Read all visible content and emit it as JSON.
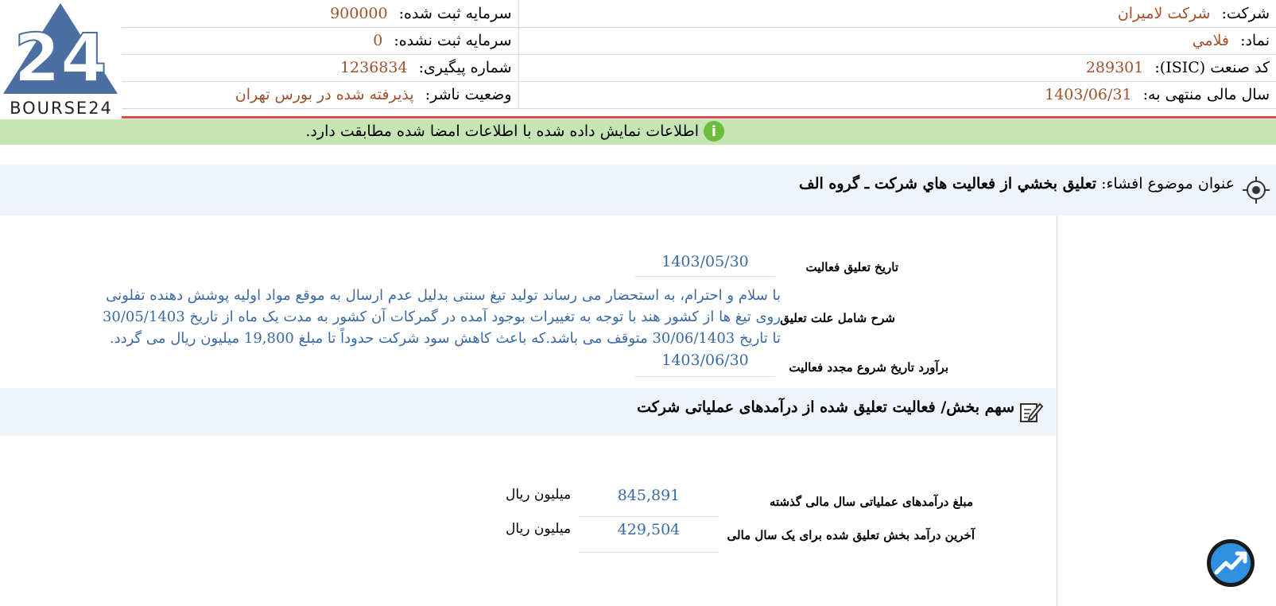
{
  "logo": {
    "text": "BOURSE24"
  },
  "header": {
    "rows": [
      {
        "right_label": "شرکت:",
        "right_value": "شرکت لامیران",
        "left_label": "سرمایه ثبت شده:",
        "left_value": "900000"
      },
      {
        "right_label": "نماد:",
        "right_value": "فلامي",
        "left_label": "سرمایه ثبت نشده:",
        "left_value": "0"
      },
      {
        "right_label": "کد صنعت (ISIC):",
        "right_value": "289301",
        "left_label": "شماره پیگیری:",
        "left_value": "1236834"
      },
      {
        "right_label": "سال مالی منتهی به:",
        "right_value": "1403/06/31",
        "left_label": "وضعیت ناشر:",
        "left_value": "پذیرفته شده در بورس تهران"
      }
    ]
  },
  "notice": {
    "text": "اطلاعات نمایش داده شده با اطلاعات امضا شده مطابقت دارد.",
    "icon": "info-icon"
  },
  "disclosure": {
    "title_label": "عنوان موضوع افشاء:",
    "title_value": "تعليق بخشي از فعاليت هاي شرکت ـ گروه الف",
    "suspension_date_label": "تاریخ تعلیق فعالیت",
    "suspension_date": "1403/05/30",
    "reason_label": "شرح شامل علت تعلیق",
    "reason_text": "با سلام و احترام، به استحضار می رساند تولید تیغ سنتی بدلیل عدم ارسال به موقع مواد اولیه پوشش دهنده تفلونی روی تیغ ها از کشور هند با توجه به تغییرات بوجود آمده در گمرکات آن کشور به مدت یک ماه از تاریخ 30/05/1403 تا تاریخ 30/06/1403 متوقف می باشد.که باعث کاهش سود شرکت حدوداً تا مبلغ 19,800 میلیون ریال می گردد.",
    "resume_date_label": "برآورد تاریخ شروع مجدد فعالیت",
    "resume_date": "1403/06/30"
  },
  "revenue_section": {
    "title": "سهم بخش/ فعالیت تعلیق شده از درآمدهای عملیاتی شرکت",
    "rows": [
      {
        "label": "مبلغ درآمدهای عملیاتی سال مالی گذشته",
        "value": "845,891",
        "unit": "میلیون ریال"
      },
      {
        "label": "آخرین درآمد بخش تعلیق شده برای یک سال مالی",
        "value": "429,504",
        "unit": "میلیون ریال"
      }
    ]
  },
  "colors": {
    "accent_value": "#a0522d",
    "blue_value": "#3a6aa3",
    "notice_bg": "#c5e5b4",
    "red_line": "#e04a4a",
    "logo_blue": "#4a6fa0"
  }
}
